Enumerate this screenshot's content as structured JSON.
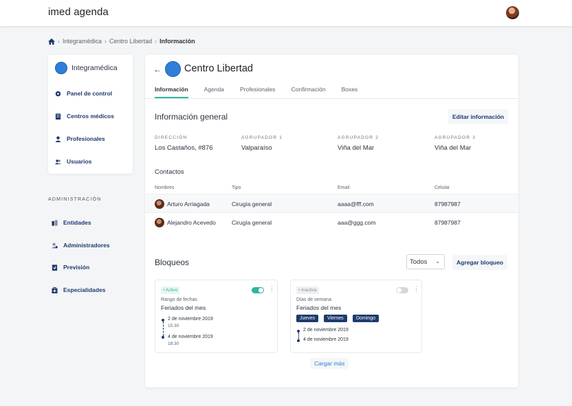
{
  "app": {
    "logo_light": "imed",
    "logo_bold": "agenda"
  },
  "breadcrumb": [
    "Integramédica",
    "Centro Libertad",
    "Información"
  ],
  "sidebar": {
    "org_name": "Integramédica",
    "items": [
      {
        "label": "Panel de control",
        "icon": "dashboard-icon"
      },
      {
        "label": "Centros médicos",
        "icon": "building-icon"
      },
      {
        "label": "Profesionales",
        "icon": "doctor-icon"
      },
      {
        "label": "Usuarios",
        "icon": "users-icon"
      }
    ],
    "admin_title": "ADMINISTRACIÓN",
    "admin_items": [
      {
        "label": "Entidades",
        "icon": "entities-icon"
      },
      {
        "label": "Administradores",
        "icon": "admin-user-icon"
      },
      {
        "label": "Previsión",
        "icon": "insurance-icon"
      },
      {
        "label": "Especialidades",
        "icon": "medical-case-icon"
      }
    ]
  },
  "center": {
    "title": "Centro Libertad",
    "tabs": [
      "Información",
      "Agenda",
      "Profesionales",
      "Confirmación",
      "Boxes"
    ],
    "active_tab": "Información"
  },
  "info": {
    "heading": "Información general",
    "edit_label": "Editar información",
    "fields": [
      {
        "label": "DIRECCIÓN",
        "value": "Los Castaños, #876"
      },
      {
        "label": "AGRUPADOR 1",
        "value": "Valparaíso"
      },
      {
        "label": "AGRUPADOR 2",
        "value": "Viña del Mar"
      },
      {
        "label": "AGRUPADOR 3",
        "value": "Viña del Mar"
      }
    ]
  },
  "contacts": {
    "heading": "Contactos",
    "columns": [
      "Nombres",
      "Tipo",
      "Email",
      "Celular"
    ],
    "rows": [
      {
        "name": "Arturo Arriagada",
        "type": "Cirugía general",
        "email": "aaaa@fff.com",
        "phone": "87987987"
      },
      {
        "name": "Alejandro Acevedo",
        "type": "Cirugía general",
        "email": "aaa@ggg.com",
        "phone": "87987987"
      }
    ]
  },
  "blocks": {
    "heading": "Bloqueos",
    "filter_value": "Todos",
    "add_label": "Agregar bloqueo",
    "load_more": "Cargar más",
    "cards": [
      {
        "status": "Activo",
        "enabled": true,
        "type": "Rango de fechas",
        "title": "Feriados del mes",
        "start_date": "2 de noviembre 2019",
        "start_time": "15:30",
        "end_date": "4 de noviembre 2019",
        "end_time": "18:30"
      },
      {
        "status": "Inactiva",
        "enabled": false,
        "type": "Días de semana",
        "title": "Feriados del mes",
        "days": [
          "Jueves",
          "Viernes",
          "Domingo"
        ],
        "start_date": "2 de noviembre 2019",
        "end_date": "4 de noviembre 2019"
      }
    ]
  },
  "colors": {
    "accent": "#2fb59a",
    "navy": "#1e3a6e",
    "brand_blue": "#2f7ed8"
  }
}
